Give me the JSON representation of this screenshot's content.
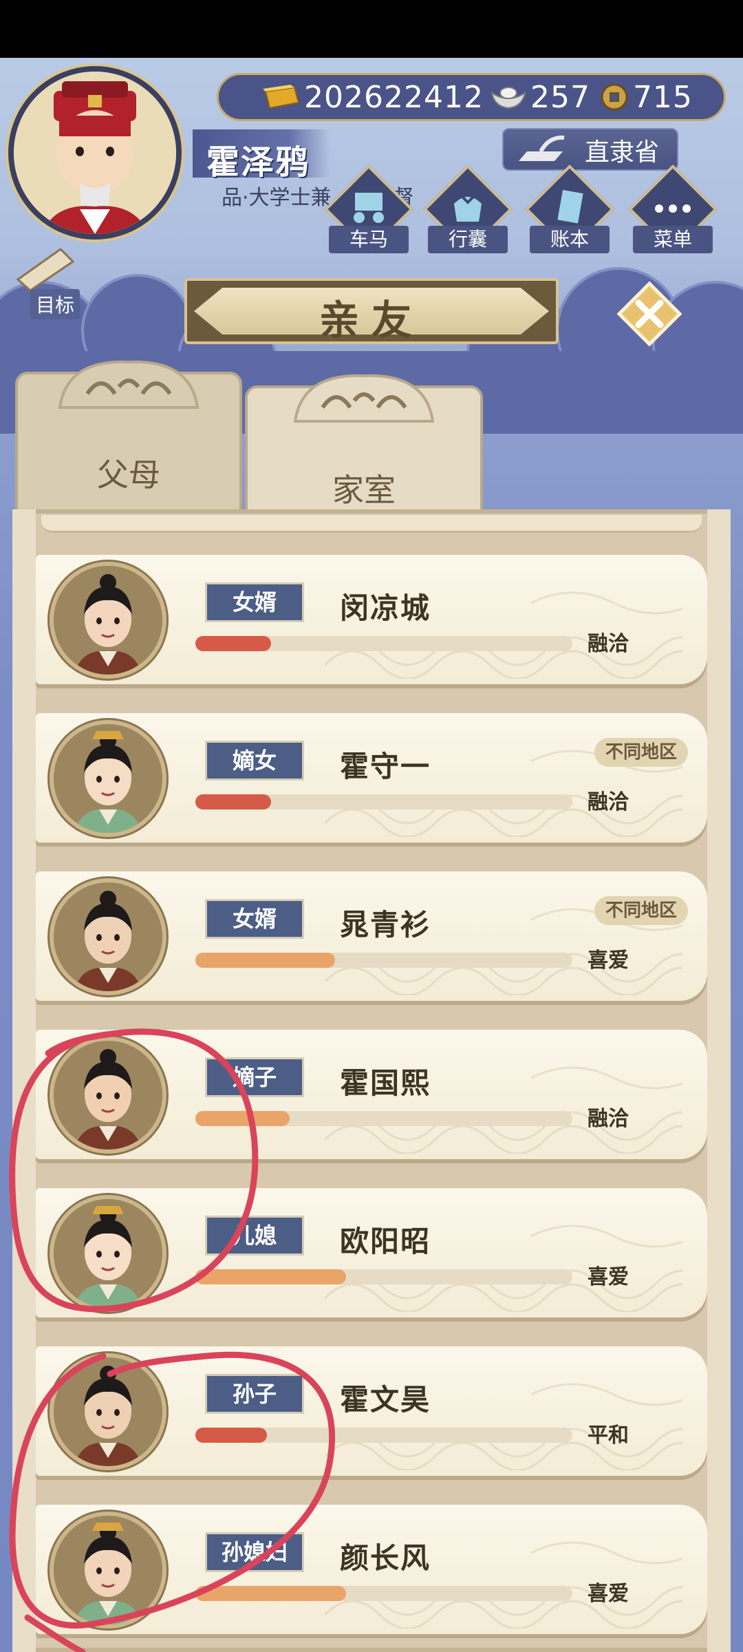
{
  "player": {
    "name": "霍泽鸦",
    "title": "品·大学士兼…隶总督"
  },
  "currency": {
    "gold": "202622412",
    "silver": "257",
    "coins": "715"
  },
  "region": "直隶省",
  "nav": [
    {
      "label": "车马"
    },
    {
      "label": "行囊"
    },
    {
      "label": "账本"
    },
    {
      "label": "菜单"
    }
  ],
  "goal_label": "目标",
  "page_title": "亲友",
  "tabs": [
    {
      "label": "父母"
    },
    {
      "label": "家室"
    }
  ],
  "relatives": [
    {
      "role": "女婿",
      "name": "闵凉城",
      "mood": "融洽",
      "region_tag": "",
      "progress": 0.2,
      "bar_color": "#d65a48"
    },
    {
      "role": "嫡女",
      "name": "霍守一",
      "mood": "融洽",
      "region_tag": "不同地区",
      "progress": 0.2,
      "bar_color": "#d65a48"
    },
    {
      "role": "女婿",
      "name": "晁青衫",
      "mood": "喜爱",
      "region_tag": "不同地区",
      "progress": 0.37,
      "bar_color": "#e9a46a"
    },
    {
      "role": "嫡子",
      "name": "霍国熙",
      "mood": "融洽",
      "region_tag": "",
      "progress": 0.25,
      "bar_color": "#e9a46a"
    },
    {
      "role": "儿媳",
      "name": "欧阳昭",
      "mood": "喜爱",
      "region_tag": "",
      "progress": 0.4,
      "bar_color": "#e9a46a"
    },
    {
      "role": "孙子",
      "name": "霍文昊",
      "mood": "平和",
      "region_tag": "",
      "progress": 0.19,
      "bar_color": "#d65a48"
    },
    {
      "role": "孙媳妇",
      "name": "颜长风",
      "mood": "喜爱",
      "region_tag": "",
      "progress": 0.4,
      "bar_color": "#e9a46a"
    }
  ],
  "colors": {
    "banner": "#6b5a3c",
    "tag": "#4c5e86",
    "annotation": "#d9445a"
  }
}
